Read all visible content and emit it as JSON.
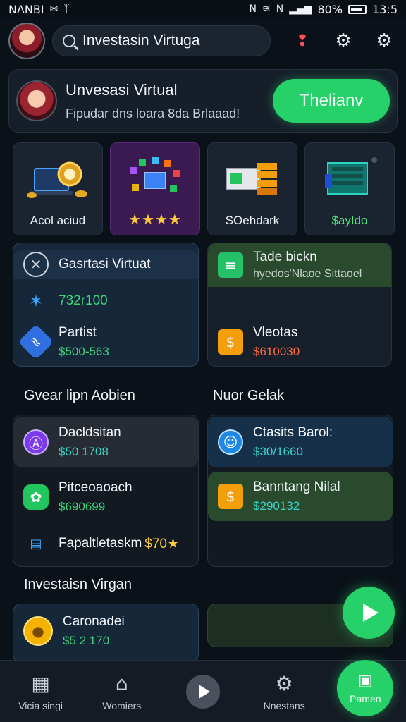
{
  "status_bar": {
    "carrier": "NΛNBI",
    "battery": "80%",
    "time": "13:5"
  },
  "search": {
    "placeholder": "Investasin Virtuga"
  },
  "hero": {
    "title": "Unvesasi Virtual",
    "subtitle": "Fipudar dns loara 8da Brlaaad!",
    "button_label": "Thelianv"
  },
  "categories": [
    {
      "label": "Acol aciud",
      "icon": "laptop-coins-icon"
    },
    {
      "label": "★★★★",
      "icon": "cubes-icon"
    },
    {
      "label": "SOehdark",
      "icon": "cash-stack-icon"
    },
    {
      "label": "$ayIdo",
      "icon": "server-icon"
    }
  ],
  "panel_left": {
    "header": "Gasrtasi Virtuat",
    "value1": "732r100",
    "item_title": "Partist",
    "item_value": "$500-563"
  },
  "panel_right": {
    "header_title": "Tade bickn",
    "header_sub": "hyedos'Nlaoe Sittaoel",
    "item_title": "Vleotas",
    "item_value": "$610030"
  },
  "section2": {
    "left_title": "Gvear lipn Aobien",
    "right_title": "Nuor Gelak"
  },
  "list_left": [
    {
      "title": "Dacldsitan",
      "value": "$50 1708"
    },
    {
      "title": "Pitceoaoach",
      "value": "$690699"
    },
    {
      "title": "Fapaltletaskm",
      "value": "$70★"
    }
  ],
  "list_right": [
    {
      "title": "Ctasits Barol:",
      "value": "$30/1660"
    },
    {
      "title": "Banntang Nilal",
      "value": "$290132"
    }
  ],
  "section3": {
    "title": "Investaisn Virgan",
    "card_title": "Caronadei",
    "card_value": "$5 2 170"
  },
  "bottom_nav": [
    {
      "label": "Vicia singi",
      "icon": "building-icon"
    },
    {
      "label": "Womiers",
      "icon": "house-icon"
    },
    {
      "label": "",
      "icon": "play-icon"
    },
    {
      "label": "Nnestans",
      "icon": "gear-icon"
    },
    {
      "label": "Pamen",
      "icon": "box-icon"
    }
  ],
  "colors": {
    "accent_green": "#27d16a",
    "bg": "#0b1118",
    "panel": "#161f2a",
    "purple_tile": "#3b1a52"
  }
}
